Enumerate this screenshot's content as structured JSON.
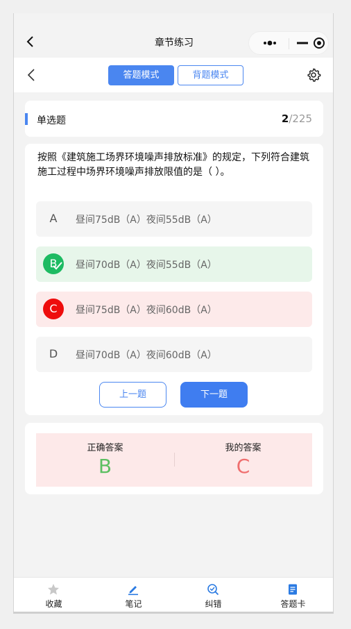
{
  "navbar": {
    "title": "章节练习"
  },
  "modebar": {
    "answer_mode": "答题模式",
    "recite_mode": "背题模式"
  },
  "question_type": {
    "label": "单选题",
    "current": "2",
    "total": "/225"
  },
  "question": {
    "text": "按照《建筑施工场界环境噪声排放标准》的规定，下列符合建筑施工过程中场界环境噪声排放限值的是（ ）。",
    "options": [
      {
        "letter": "A",
        "text": "昼间75dB（A）夜间55dB（A）",
        "state": "neutral"
      },
      {
        "letter": "B",
        "text": "昼间70dB（A）夜间55dB（A）",
        "state": "correct"
      },
      {
        "letter": "C",
        "text": "昼间75dB（A）夜间60dB（A）",
        "state": "wrong"
      },
      {
        "letter": "D",
        "text": "昼间70dB（A）夜间60dB（A）",
        "state": "neutral"
      }
    ]
  },
  "buttons": {
    "prev": "上一题",
    "next": "下一题"
  },
  "answer": {
    "correct_label": "正确答案",
    "correct_value": "B",
    "mine_label": "我的答案",
    "mine_value": "C"
  },
  "tabbar": {
    "items": [
      {
        "label": "收藏",
        "icon": "star-icon"
      },
      {
        "label": "笔记",
        "icon": "pencil-icon"
      },
      {
        "label": "纠错",
        "icon": "search-correct-icon"
      },
      {
        "label": "答题卡",
        "icon": "answer-card-icon"
      }
    ]
  },
  "colors": {
    "accent": "#4a86f0",
    "correct": "#1dbb62",
    "wrong": "#ee0d0d",
    "correct_bg": "#e7f6ea",
    "wrong_bg": "#fdeaea"
  }
}
